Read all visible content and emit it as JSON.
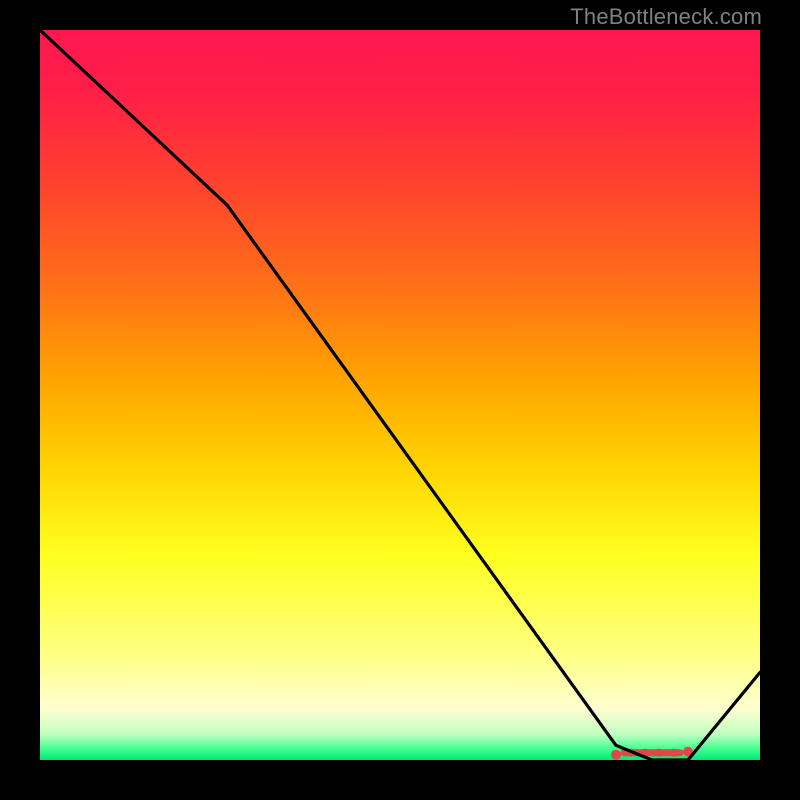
{
  "watermark": "TheBottleneck.com",
  "chart_data": {
    "type": "line",
    "x": [
      0,
      26,
      80,
      85,
      90,
      100
    ],
    "y": [
      100,
      76,
      2,
      0,
      0,
      12
    ],
    "xlim": [
      0,
      100
    ],
    "ylim": [
      0,
      100
    ],
    "title": "",
    "xlabel": "",
    "ylabel": "",
    "marker_band": {
      "x_start": 80,
      "x_end": 90,
      "y": 1
    },
    "gradient_stops": [
      {
        "offset": 0.0,
        "color": "#ff1850"
      },
      {
        "offset": 0.08,
        "color": "#ff1e48"
      },
      {
        "offset": 0.2,
        "color": "#ff3e30"
      },
      {
        "offset": 0.35,
        "color": "#ff7018"
      },
      {
        "offset": 0.48,
        "color": "#ffa400"
      },
      {
        "offset": 0.6,
        "color": "#ffd400"
      },
      {
        "offset": 0.72,
        "color": "#ffff20"
      },
      {
        "offset": 0.85,
        "color": "#ffff80"
      },
      {
        "offset": 0.93,
        "color": "#ffffd0"
      },
      {
        "offset": 0.965,
        "color": "#c0ffc0"
      },
      {
        "offset": 0.985,
        "color": "#40ff90"
      },
      {
        "offset": 1.0,
        "color": "#00e878"
      }
    ],
    "line_color": "#000000",
    "marker_color": "#e04848"
  }
}
